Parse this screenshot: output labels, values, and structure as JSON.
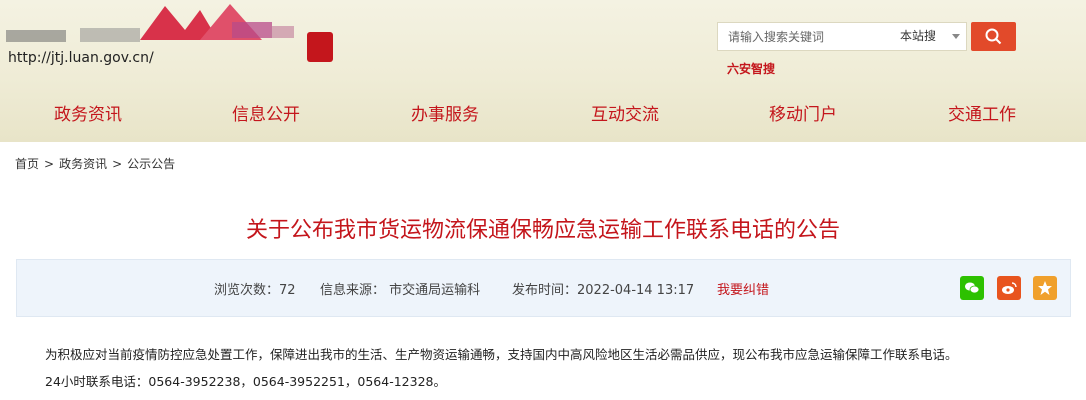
{
  "header": {
    "url_text": "http://jtj.luan.gov.cn/",
    "search_placeholder": "请输入搜索关键词",
    "search_scope": "本站搜",
    "smart_link": "六安智搜"
  },
  "nav": {
    "items": [
      {
        "label": "政务资讯"
      },
      {
        "label": "信息公开"
      },
      {
        "label": "办事服务"
      },
      {
        "label": "互动交流"
      },
      {
        "label": "移动门户"
      },
      {
        "label": "交通工作"
      }
    ]
  },
  "breadcrumb": {
    "items": [
      "首页",
      "政务资讯",
      "公示公告"
    ],
    "separator": ">"
  },
  "article": {
    "title": "关于公布我市货运物流保通保畅应急运输工作联系电话的公告",
    "views": "浏览次数：72",
    "source": "信息来源：  市交通局运输科",
    "date": "发布时间：2022-04-14 13:17",
    "report_error": "我要纠错",
    "paragraphs": [
      "为积极应对当前疫情防控应急处置工作，保障进出我市的生活、生产物资运输通畅，支持国内中高风险地区生活必需品供应，现公布我市应急运输保障工作联系电话。",
      "24小时联系电话：0564-3952238，0564-3952251，0564-12328。"
    ]
  },
  "share": {
    "icons": [
      "wechat-icon",
      "weibo-icon",
      "favorite-star-icon"
    ],
    "colors": {
      "wechat": "#2dc100",
      "weibo": "#e8541e",
      "favorite": "#f0a02c"
    }
  },
  "colors": {
    "accent_red": "#c4161c",
    "header_bg": "#efecd6",
    "meta_bg": "#eef4fb",
    "search_button": "#e24a2a"
  }
}
